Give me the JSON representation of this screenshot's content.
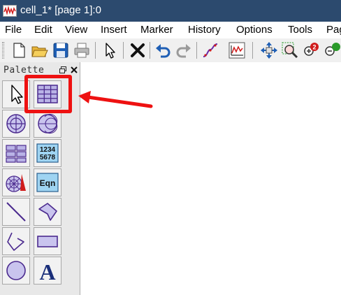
{
  "window": {
    "title": "cell_1* [page 1]:0"
  },
  "menu": {
    "items": [
      "File",
      "Edit",
      "View",
      "Insert",
      "Marker",
      "History",
      "Options",
      "Tools",
      "Page"
    ]
  },
  "toolbar": {
    "buttons": [
      "new-file-icon",
      "open-folder-icon",
      "save-icon",
      "print-icon",
      "select-arrow-icon",
      "delete-x-icon",
      "undo-icon",
      "redo-icon",
      "curve-fit-icon",
      "graph-plot-icon",
      "move-icon",
      "zoom-fit-icon",
      "zoom-in-icon",
      "zoom-out-icon"
    ]
  },
  "palette": {
    "title": "Palette",
    "tools": [
      "pointer-arrow-icon",
      "table-grid-icon",
      "polar-graph-icon",
      "smith-chart-icon",
      "matrix-table-icon",
      "numeric-display-icon",
      "antenna-pattern-icon",
      "equation-icon",
      "line-icon",
      "polygon-icon",
      "polyline-icon",
      "rectangle-icon",
      "ellipse-icon",
      "text-icon"
    ],
    "numeric_display_text": [
      "1234",
      "5678"
    ],
    "equation_label": "Eqn",
    "text_tool_label": "A"
  },
  "annotation": {
    "highlight_color": "#ee1111",
    "arrow_color": "#ee1111"
  },
  "colors": {
    "titlebar_bg": "#2c4a6e",
    "toolbar_bg": "#f0f0f0",
    "palette_bg": "#e8e8e8",
    "tool_purple": "#4b2a8e"
  }
}
